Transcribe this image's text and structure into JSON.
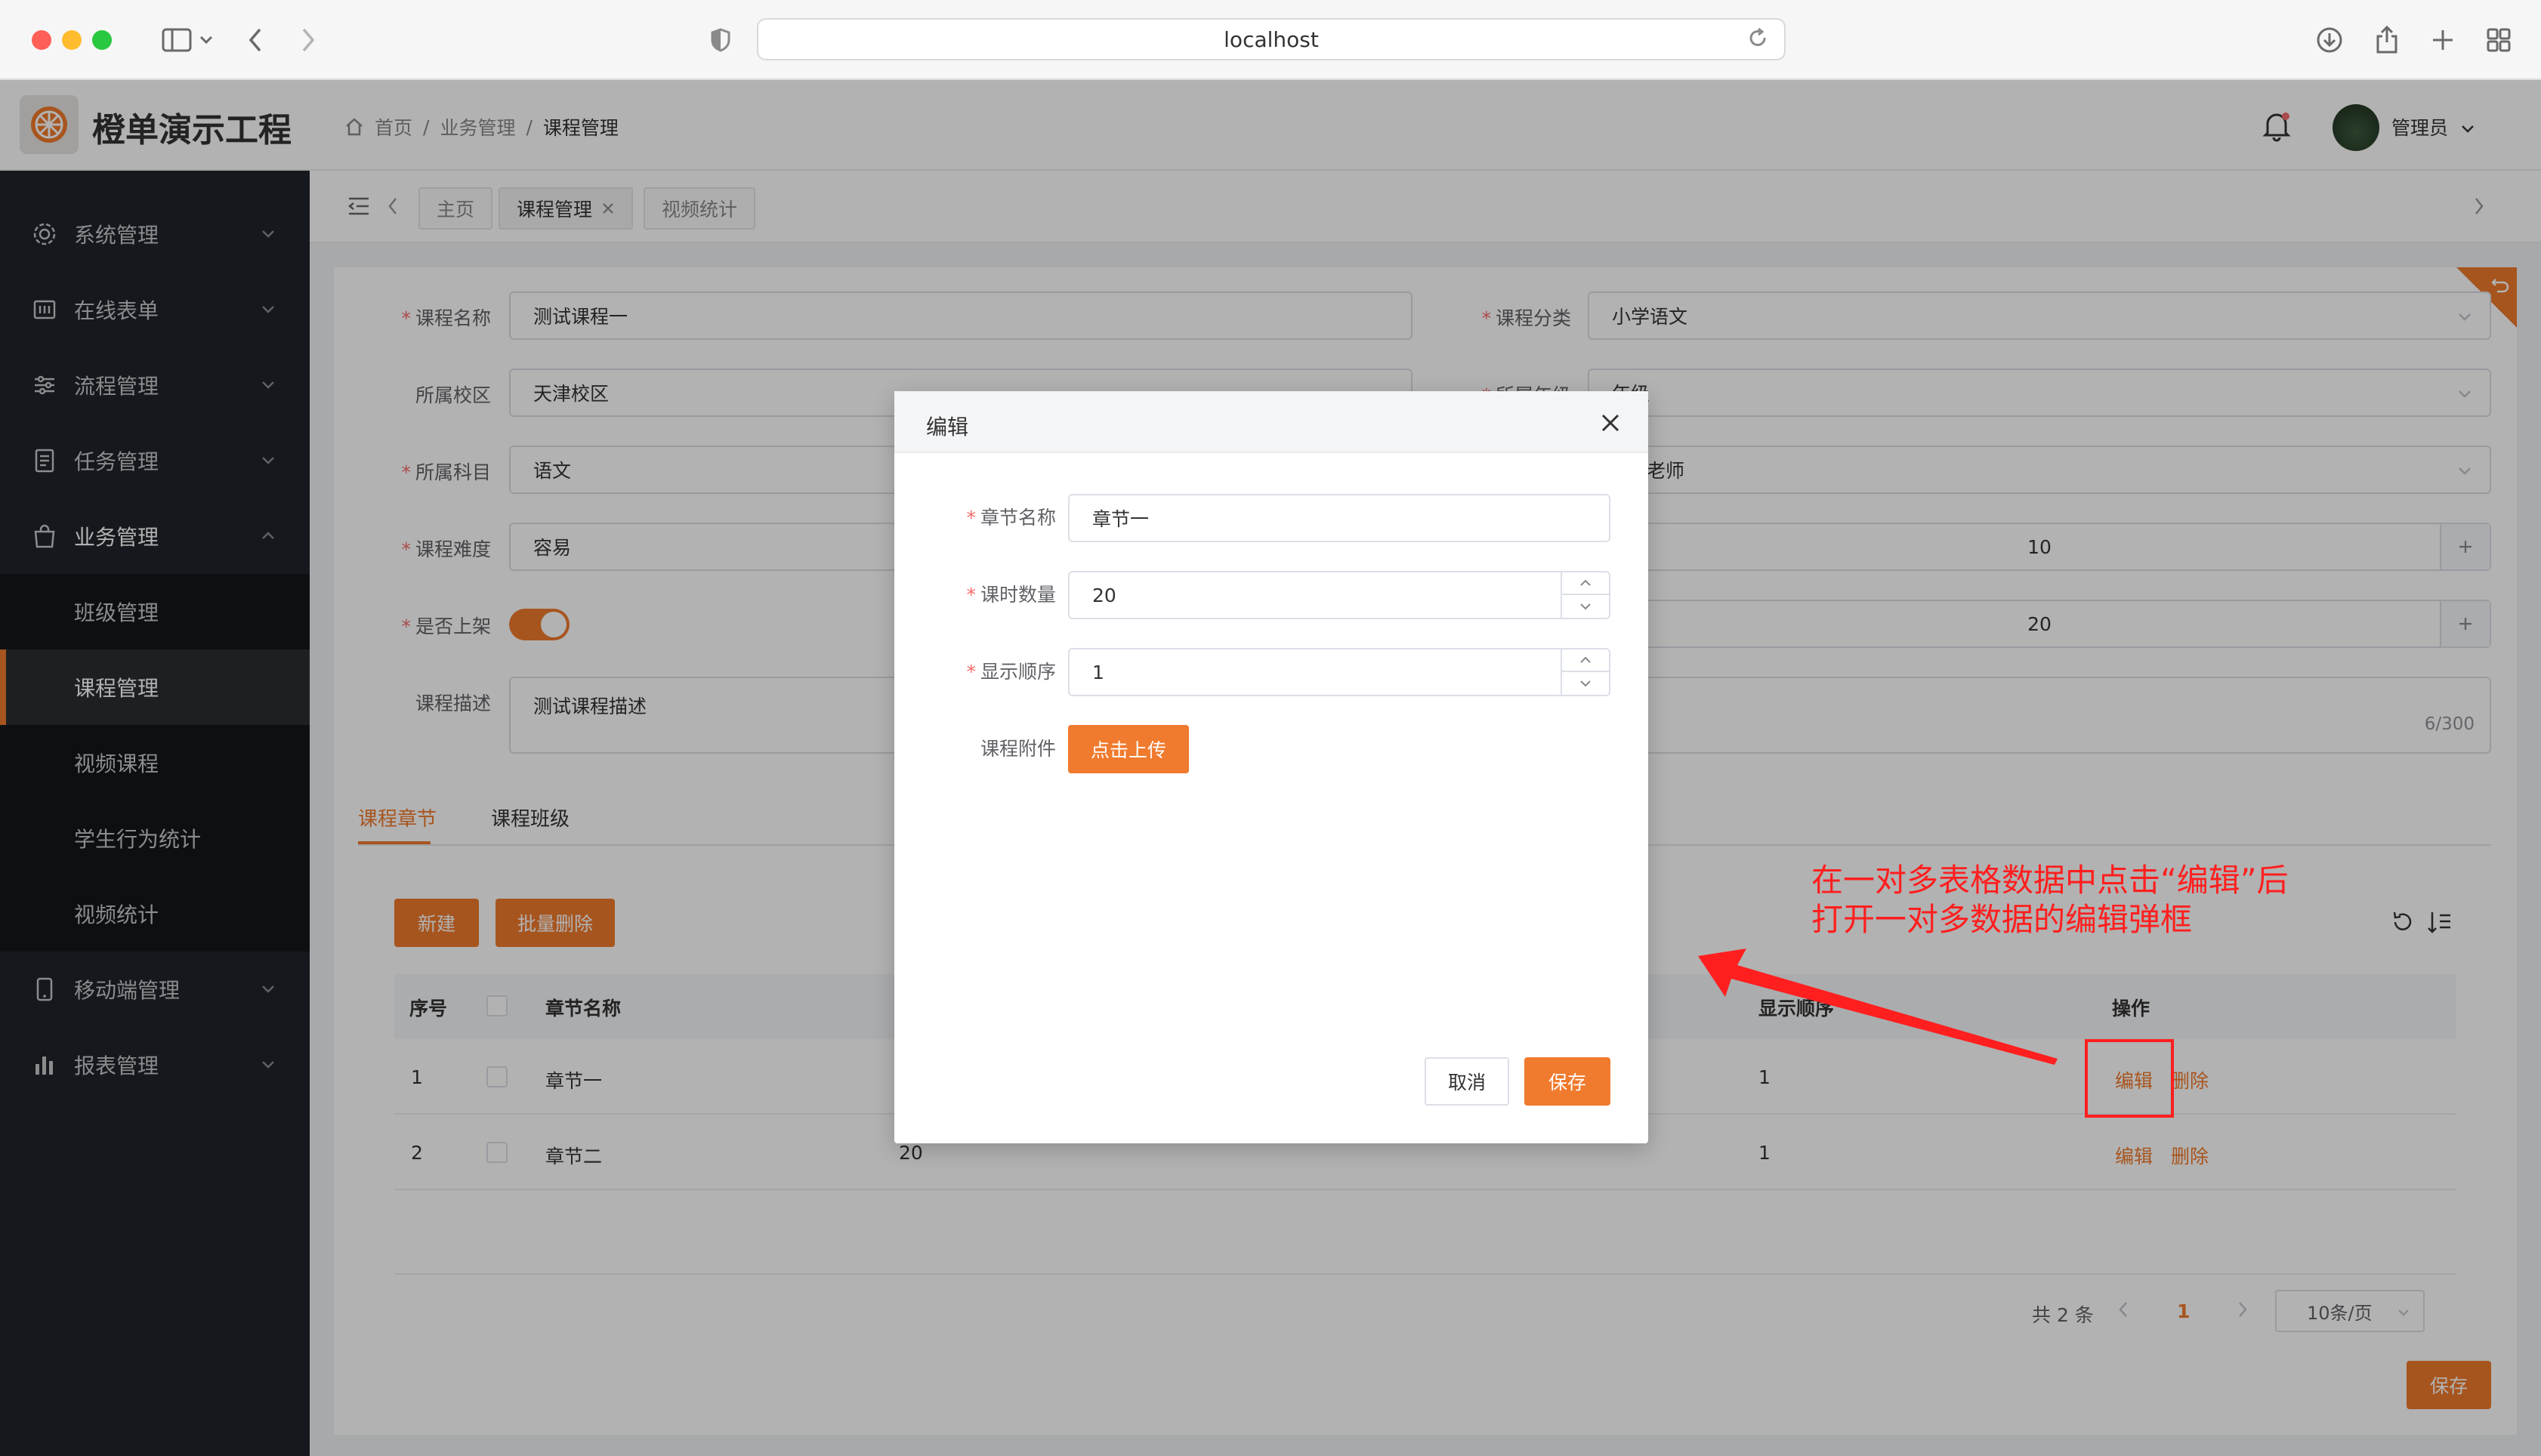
{
  "browser": {
    "url": "localhost"
  },
  "app": {
    "title": "橙单演示工程"
  },
  "breadcrumb": {
    "home": "首页",
    "sep": "/",
    "level2": "业务管理",
    "current": "课程管理"
  },
  "user": {
    "name": "管理员"
  },
  "sidebar": {
    "items": [
      {
        "label": "系统管理"
      },
      {
        "label": "在线表单"
      },
      {
        "label": "流程管理"
      },
      {
        "label": "任务管理"
      },
      {
        "label": "业务管理"
      },
      {
        "label": "班级管理"
      },
      {
        "label": "课程管理"
      },
      {
        "label": "视频课程"
      },
      {
        "label": "学生行为统计"
      },
      {
        "label": "视频统计"
      },
      {
        "label": "移动端管理"
      },
      {
        "label": "报表管理"
      }
    ]
  },
  "tabs": [
    {
      "label": "主页"
    },
    {
      "label": "课程管理"
    },
    {
      "label": "视频统计"
    }
  ],
  "form": {
    "course_name_label": "课程名称",
    "course_name_value": "测试课程一",
    "course_category_label": "课程分类",
    "course_category_value": "小学语文",
    "campus_label": "所属校区",
    "campus_value": "天津校区",
    "grade_label": "所属年级",
    "grade_value": "年级",
    "subject_label": "所属科目",
    "subject_value": "语文",
    "teacher_value": "老师",
    "difficulty_label": "课程难度",
    "difficulty_value": "容易",
    "num_value_1": "10",
    "num_value_2": "20",
    "on_shelf_label": "是否上架",
    "desc_label": "课程描述",
    "desc_value": "测试课程描述",
    "desc_count": "6/300"
  },
  "subtabs": [
    {
      "label": "课程章节"
    },
    {
      "label": "课程班级"
    }
  ],
  "toolbar": {
    "new_label": "新建",
    "batch_delete_label": "批量删除"
  },
  "table": {
    "headers": {
      "index": "序号",
      "chapter_name": "章节名称",
      "display_order": "显示顺序",
      "actions": "操作"
    },
    "rows": [
      {
        "index": "1",
        "name": "章节一",
        "hours": "",
        "order": "1",
        "edit": "编辑",
        "delete": "删除"
      },
      {
        "index": "2",
        "name": "章节二",
        "hours": "20",
        "order": "1",
        "edit": "编辑",
        "delete": "删除"
      }
    ]
  },
  "pagination": {
    "total": "共 2 条",
    "page": "1",
    "page_size": "10条/页"
  },
  "footer": {
    "save_label": "保存"
  },
  "modal": {
    "title": "编辑",
    "chapter_name_label": "章节名称",
    "chapter_name_value": "章节一",
    "hours_label": "课时数量",
    "hours_value": "20",
    "order_label": "显示顺序",
    "order_value": "1",
    "attachment_label": "课程附件",
    "upload_label": "点击上传",
    "cancel_label": "取消",
    "save_label": "保存"
  },
  "annotation": {
    "line1": "在一对多表格数据中点击“编辑”后",
    "line2": "打开一对多数据的编辑弹框"
  },
  "colors": {
    "accent": "#f07a2d",
    "sidebar_bg": "#1f2329",
    "annotation": "#ff1f1f"
  }
}
